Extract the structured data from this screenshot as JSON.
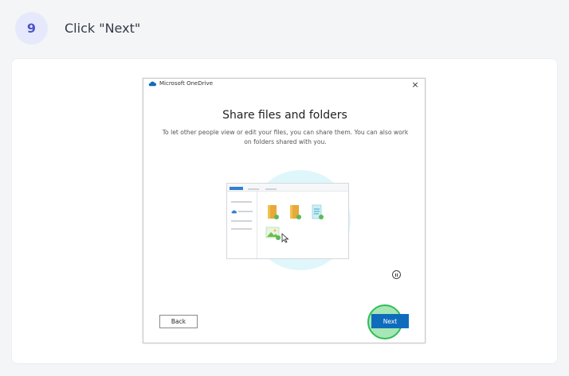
{
  "step": {
    "number": "9",
    "instruction": "Click \"Next\""
  },
  "window": {
    "app_title": "Microsoft OneDrive",
    "close_symbol": "×",
    "heading": "Share files and folders",
    "description": "To let other people view or edit your files, you can share them. You can also work on folders shared with you."
  },
  "buttons": {
    "back_label": "Back",
    "next_label": "Next"
  },
  "colors": {
    "accent": "#0f6cbd",
    "step_badge": "#4b56c9",
    "highlight": "#2fbe58"
  },
  "icons": [
    "onedrive-cloud-icon",
    "close-icon",
    "folder-icon",
    "document-icon",
    "image-icon",
    "cursor-icon",
    "pause-icon"
  ]
}
